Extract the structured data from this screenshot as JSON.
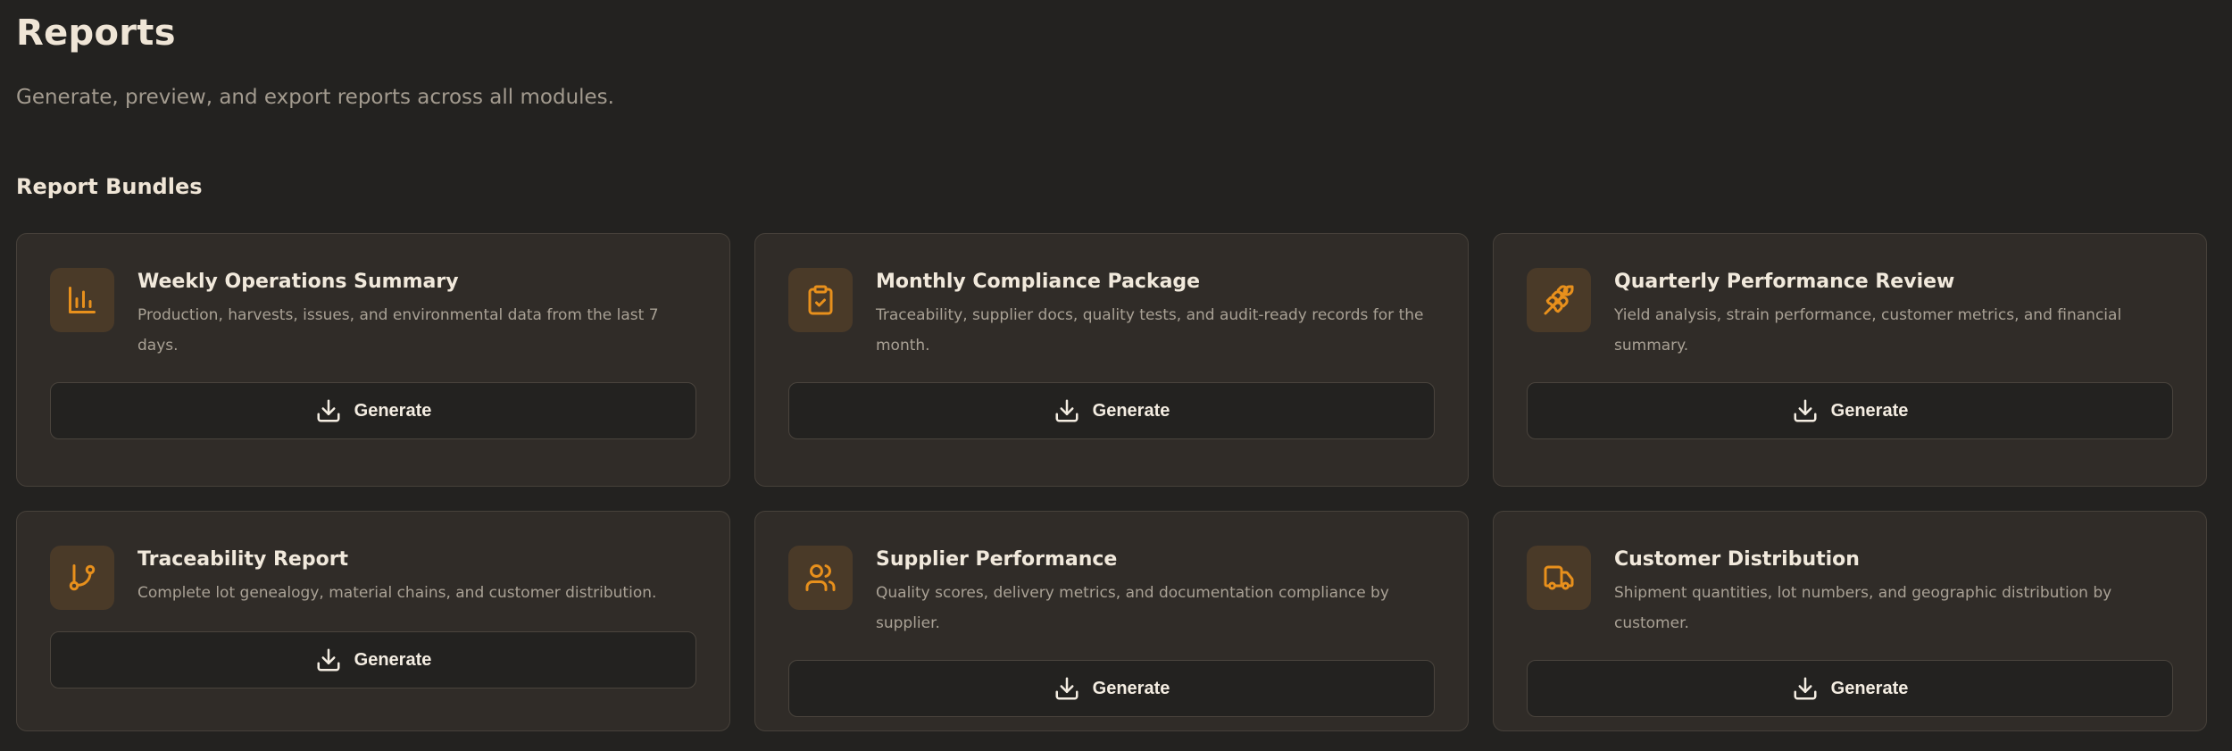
{
  "header": {
    "title": "Reports",
    "subtitle": "Generate, preview, and export reports across all modules."
  },
  "bundles": {
    "section_title": "Report Bundles",
    "items": [
      {
        "title": "Weekly Operations Summary",
        "description": "Production, harvests, issues, and environmental data from the last 7 days.",
        "icon": "bar-chart-icon",
        "button_label": "Generate"
      },
      {
        "title": "Monthly Compliance Package",
        "description": "Traceability, supplier docs, quality tests, and audit-ready records for the month.",
        "icon": "clipboard-check-icon",
        "button_label": "Generate"
      },
      {
        "title": "Quarterly Performance Review",
        "description": "Yield analysis, strain performance, customer metrics, and financial summary.",
        "icon": "wheat-icon",
        "button_label": "Generate"
      },
      {
        "title": "Traceability Report",
        "description": "Complete lot genealogy, material chains, and customer distribution.",
        "icon": "git-branch-icon",
        "button_label": "Generate"
      },
      {
        "title": "Supplier Performance",
        "description": "Quality scores, delivery metrics, and documentation compliance by supplier.",
        "icon": "users-icon",
        "button_label": "Generate"
      },
      {
        "title": "Customer Distribution",
        "description": "Shipment quantities, lot numbers, and geographic distribution by customer.",
        "icon": "truck-icon",
        "button_label": "Generate"
      }
    ]
  },
  "colors": {
    "background": "#232220",
    "card": "#302c28",
    "accent": "#e8901c",
    "icon_bg": "#4a3a28"
  }
}
